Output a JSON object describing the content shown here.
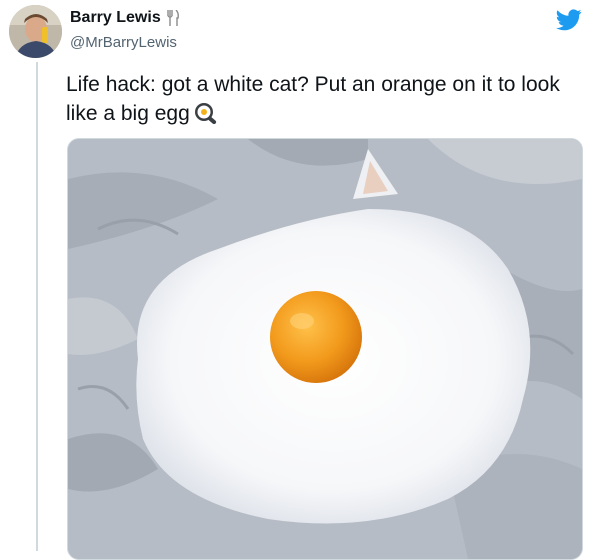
{
  "tweet": {
    "author_name": "Barry Lewis",
    "author_handle": "@MrBarryLewis",
    "text": "Life hack: got a white cat? Put an orange on it to look like a big egg",
    "emoji_icon": "frying-pan-egg-icon",
    "name_icon": "fork-and-knife-icon",
    "platform_icon": "twitter-bird-icon"
  },
  "colors": {
    "twitter_blue": "#1d9bf0",
    "text_primary": "#0f1419",
    "text_secondary": "#536471",
    "orange": "#f29a1c"
  }
}
